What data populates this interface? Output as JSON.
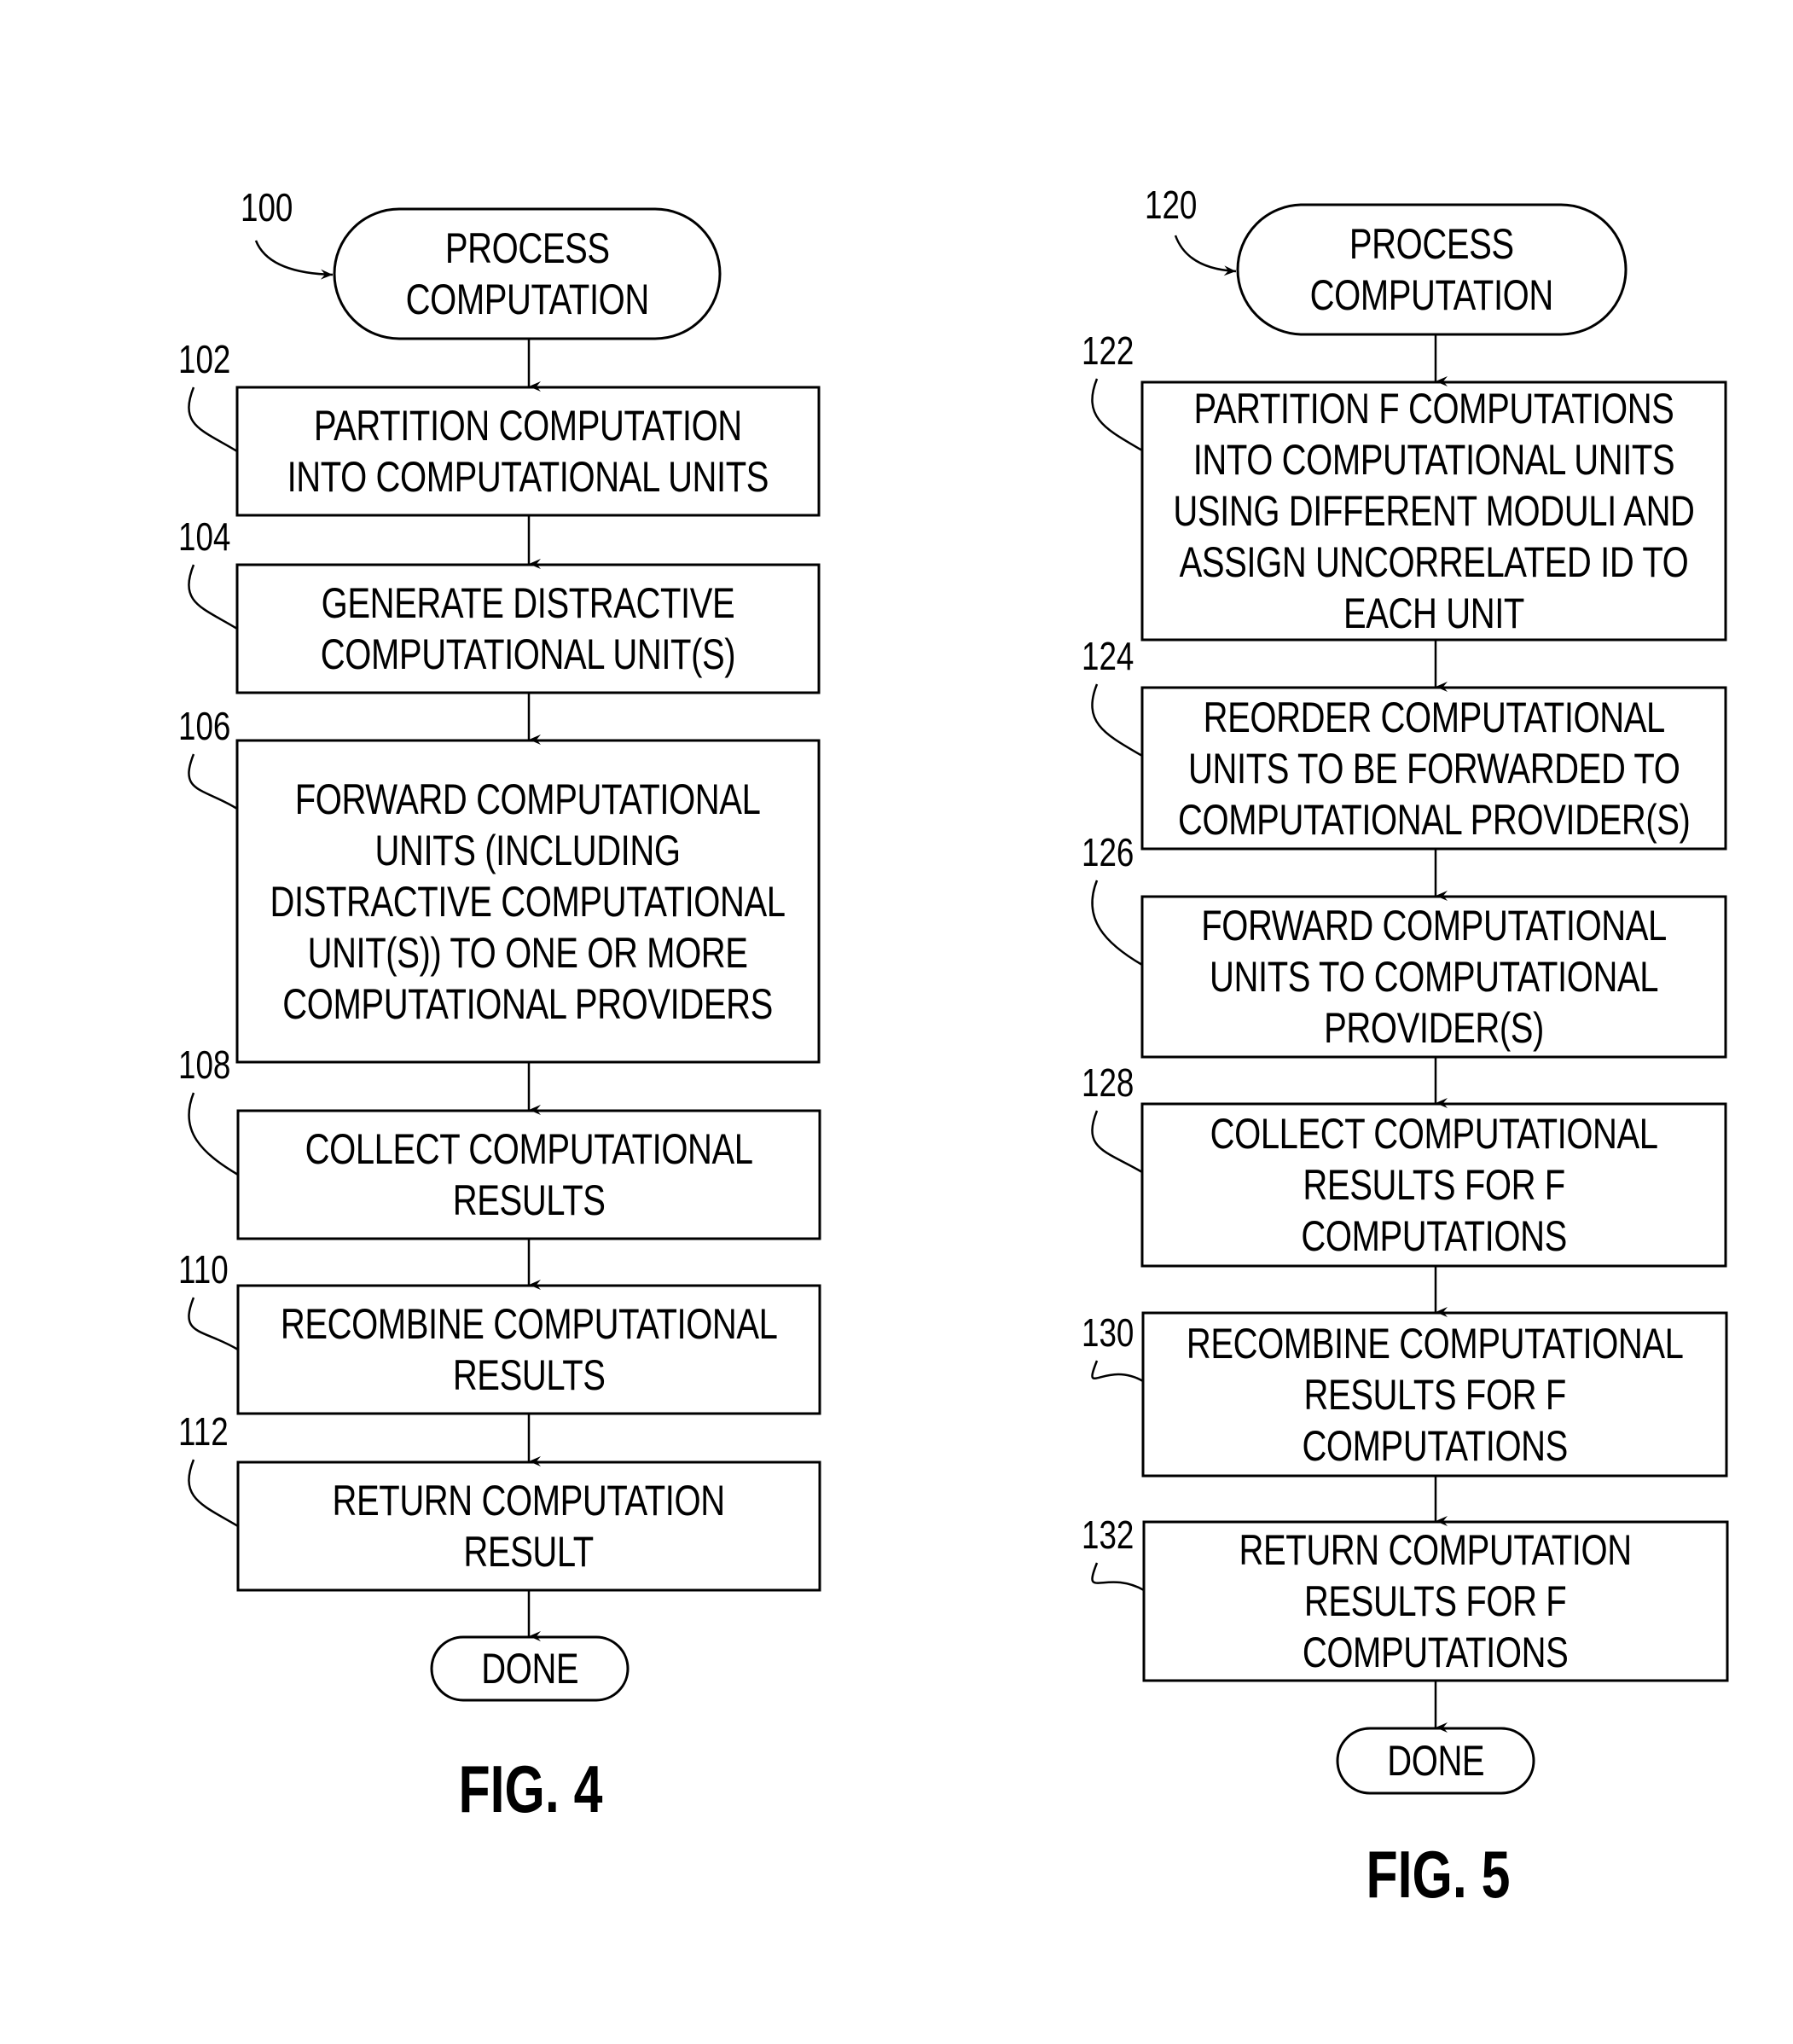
{
  "figures": [
    {
      "label": "FIG. 4",
      "start": {
        "ref": "100",
        "lines": [
          "PROCESS",
          "COMPUTATION"
        ]
      },
      "steps": [
        {
          "ref": "102",
          "lines": [
            "PARTITION COMPUTATION",
            "INTO COMPUTATIONAL UNITS"
          ]
        },
        {
          "ref": "104",
          "lines": [
            "GENERATE DISTRACTIVE",
            "COMPUTATIONAL UNIT(S)"
          ]
        },
        {
          "ref": "106",
          "lines": [
            "FORWARD COMPUTATIONAL",
            "UNITS (INCLUDING",
            "DISTRACTIVE COMPUTATIONAL",
            "UNIT(S)) TO ONE OR MORE",
            "COMPUTATIONAL PROVIDERS"
          ]
        },
        {
          "ref": "108",
          "lines": [
            "COLLECT COMPUTATIONAL",
            "RESULTS"
          ]
        },
        {
          "ref": "110",
          "lines": [
            "RECOMBINE COMPUTATIONAL",
            "RESULTS"
          ]
        },
        {
          "ref": "112",
          "lines": [
            "RETURN COMPUTATION",
            "RESULT"
          ]
        }
      ],
      "end": {
        "lines": [
          "DONE"
        ]
      }
    },
    {
      "label": "FIG. 5",
      "start": {
        "ref": "120",
        "lines": [
          "PROCESS",
          "COMPUTATION"
        ]
      },
      "steps": [
        {
          "ref": "122",
          "lines": [
            "PARTITION F COMPUTATIONS",
            "INTO COMPUTATIONAL UNITS",
            "USING DIFFERENT MODULI AND",
            "ASSIGN UNCORRELATED ID TO",
            "EACH UNIT"
          ]
        },
        {
          "ref": "124",
          "lines": [
            "REORDER COMPUTATIONAL",
            "UNITS TO BE FORWARDED TO",
            "COMPUTATIONAL PROVIDER(S)"
          ]
        },
        {
          "ref": "126",
          "lines": [
            "FORWARD COMPUTATIONAL",
            "UNITS TO COMPUTATIONAL",
            "PROVIDER(S)"
          ]
        },
        {
          "ref": "128",
          "lines": [
            "COLLECT COMPUTATIONAL",
            "RESULTS FOR F",
            "COMPUTATIONS"
          ]
        },
        {
          "ref": "130",
          "lines": [
            "RECOMBINE COMPUTATIONAL",
            "RESULTS FOR F",
            "COMPUTATIONS"
          ]
        },
        {
          "ref": "132",
          "lines": [
            "RETURN COMPUTATION",
            "RESULTS FOR F",
            "COMPUTATIONS"
          ]
        }
      ],
      "end": {
        "lines": [
          "DONE"
        ]
      }
    }
  ],
  "colors": {
    "ink": "#000000",
    "paper": "#ffffff"
  }
}
